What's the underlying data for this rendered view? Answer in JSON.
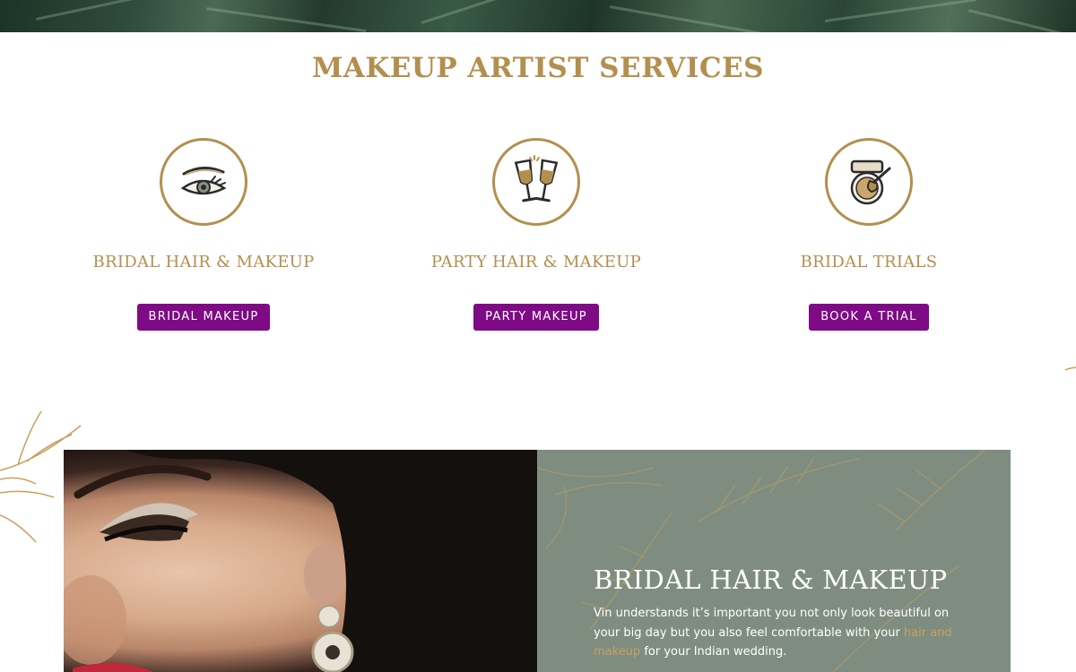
{
  "section": {
    "title": "MAKEUP ARTIST SERVICES"
  },
  "services": [
    {
      "icon": "eye-makeup-icon",
      "name": "BRIDAL HAIR & MAKEUP",
      "button": "BRIDAL MAKEUP"
    },
    {
      "icon": "champagne-glasses-icon",
      "name": "PARTY HAIR & MAKEUP",
      "button": "PARTY MAKEUP"
    },
    {
      "icon": "powder-compact-brush-icon",
      "name": "BRIDAL TRIALS",
      "button": "BOOK A TRIAL"
    }
  ],
  "feature": {
    "heading": "BRIDAL HAIR & MAKEUP",
    "body_before": "Vin understands it’s important you not only look beautiful on your big day but you also feel comfortable with your ",
    "body_link": "hair and makeup",
    "body_after": " for your Indian wedding."
  },
  "colors": {
    "gold": "#b38f4f",
    "button": "#7e0a86",
    "panel": "#7f8d81",
    "link": "#c9a05c"
  }
}
